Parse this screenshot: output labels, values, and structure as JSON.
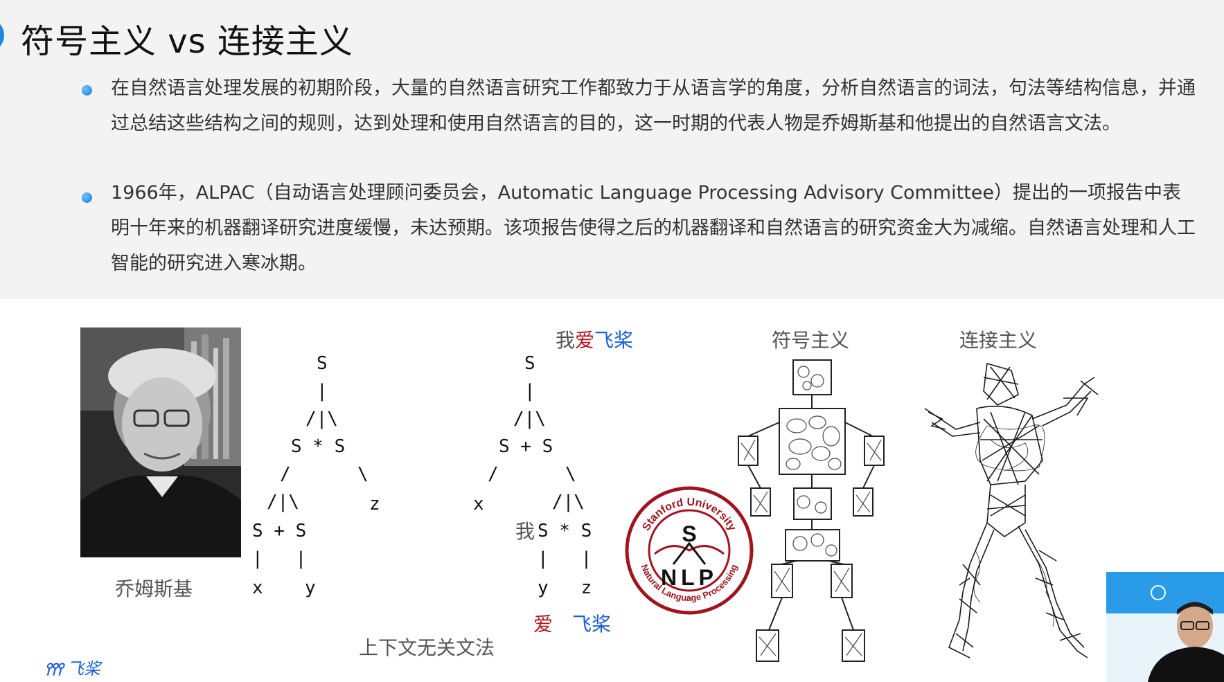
{
  "slide": {
    "title": "符号主义 vs 连接主义",
    "bullets": [
      "在自然语言处理发展的初期阶段，大量的自然语言研究工作都致力于从语言学的角度，分析自然语言的词法，句法等结构信息，并通过总结这些结构之间的规则，达到处理和使用自然语言的目的，这一时期的代表人物是乔姆斯基和他提出的自然语言文法。",
      "1966年，ALPAC（自动语言处理顾问委员会，Automatic Language Processing Advisory Committee）提出的一项报告中表明十年来的机器翻译研究进度缓慢，未达预期。该项报告使得之后的机器翻译和自然语言的研究资金大为减缩。自然语言处理和人工智能的研究进入寒冰期。"
    ]
  },
  "figures": {
    "photo_caption": "乔姆斯基",
    "grammar_caption": "上下文无关文法",
    "sentence": {
      "w1": "我",
      "w2": "爱",
      "w3": "飞桨"
    },
    "tree1": {
      "root": "S",
      "bar": "|",
      "branch": "/|\\",
      "mid": "S * S",
      "left_slash": "/",
      "right_slash": "\\",
      "sub": "/|\\",
      "sub_nodes": "S + S",
      "z": "z",
      "bars": "|   |",
      "leaves_x": "x",
      "leaves_y": "y"
    },
    "tree2": {
      "root": "S",
      "bar": "|",
      "branch": "/|\\",
      "mid": "S + S",
      "left_slash": "/",
      "right_slash": "\\",
      "x": "x",
      "sub": "/|\\",
      "sub_prefix": "我",
      "sub_nodes": "S * S",
      "bars": "|   |",
      "leaves": "y   z",
      "word_ai": "爱",
      "word_feijiang": "飞桨"
    },
    "symbolism_label": "符号主义",
    "connectionism_label": "连接主义",
    "logo": {
      "top_text": "Stanford University",
      "bottom_text": "Natural Language Processing",
      "letter_s": "S",
      "nlp": "NLP"
    },
    "brand": {
      "logo_text": "飞桨"
    }
  },
  "colors": {
    "accent": "#1e88e5",
    "red": "#b0141e",
    "blue": "#1a5fd6",
    "seal_red": "#a01420"
  }
}
